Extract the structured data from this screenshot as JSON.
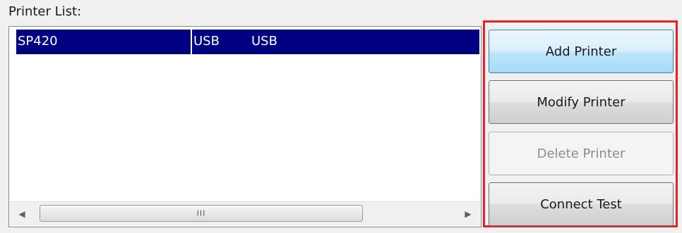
{
  "printer_list": {
    "label": "Printer List:",
    "rows": [
      {
        "name": "SP420",
        "connection": "USB",
        "port": "USB",
        "selected": true
      }
    ],
    "scrollbar": {
      "left_arrow": "◀",
      "right_arrow": "▶",
      "grip": "III"
    }
  },
  "buttons": {
    "add": "Add Printer",
    "modify": "Modify Printer",
    "delete": "Delete Printer",
    "connect": "Connect Test"
  },
  "colors": {
    "selection": "#000080",
    "highlight_border": "#e8202a",
    "hover_button": "#bee6fd"
  }
}
